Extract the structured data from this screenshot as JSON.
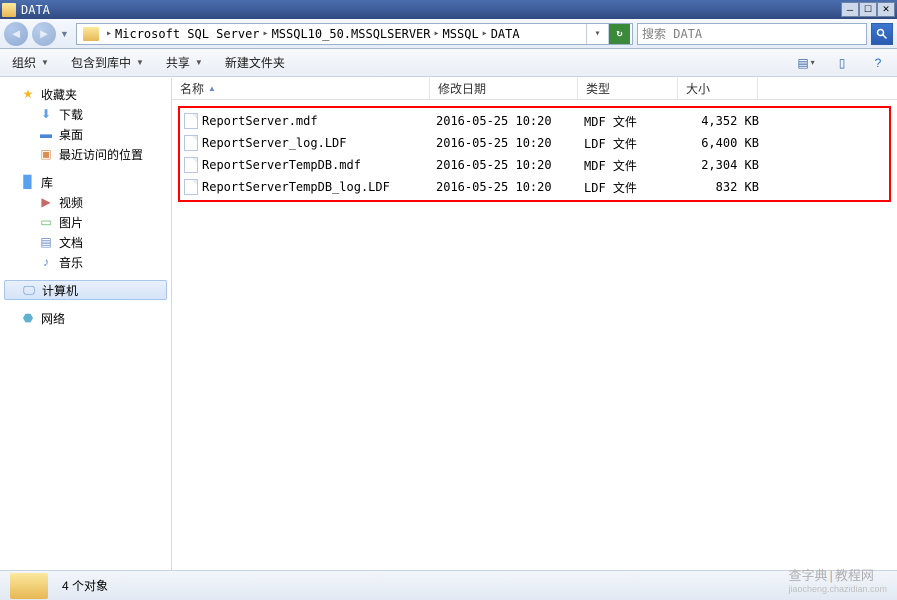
{
  "title": "DATA",
  "breadcrumb": {
    "items": [
      "Microsoft SQL Server",
      "MSSQL10_50.MSSQLSERVER",
      "MSSQL",
      "DATA"
    ]
  },
  "search": {
    "placeholder": "搜索 DATA"
  },
  "toolbar": {
    "organize": "组织",
    "include": "包含到库中",
    "share": "共享",
    "newfolder": "新建文件夹"
  },
  "navtree": {
    "favorites": {
      "label": "收藏夹",
      "items": {
        "downloads": "下载",
        "desktop": "桌面",
        "recent": "最近访问的位置"
      }
    },
    "library": {
      "label": "库",
      "items": {
        "videos": "视频",
        "pictures": "图片",
        "documents": "文档",
        "music": "音乐"
      }
    },
    "computer": "计算机",
    "network": "网络"
  },
  "columns": {
    "name": "名称",
    "date": "修改日期",
    "type": "类型",
    "size": "大小"
  },
  "files": [
    {
      "name": "ReportServer.mdf",
      "date": "2016-05-25 10:20",
      "type": "MDF 文件",
      "size": "4,352 KB"
    },
    {
      "name": "ReportServer_log.LDF",
      "date": "2016-05-25 10:20",
      "type": "LDF 文件",
      "size": "6,400 KB"
    },
    {
      "name": "ReportServerTempDB.mdf",
      "date": "2016-05-25 10:20",
      "type": "MDF 文件",
      "size": "2,304 KB"
    },
    {
      "name": "ReportServerTempDB_log.LDF",
      "date": "2016-05-25 10:20",
      "type": "LDF 文件",
      "size": "832 KB"
    }
  ],
  "statusbar": {
    "count": "4 个对象"
  },
  "watermark": {
    "main": "查字典",
    "sep": "|",
    "sub1": "教程网",
    "sub2": "jiaocheng.chazidian.com"
  }
}
